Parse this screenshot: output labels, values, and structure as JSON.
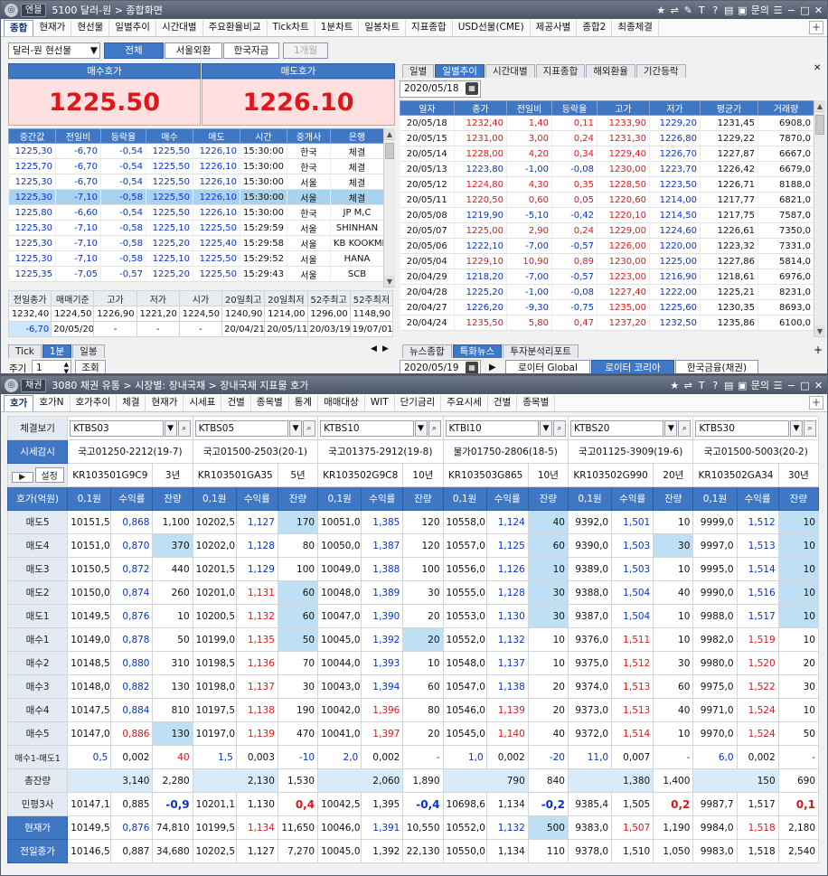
{
  "top": {
    "badge": "엔블",
    "title": "5100 달러-원 > 종합화면",
    "right_label": "문의",
    "menu": [
      "종합",
      "현재가",
      "현선물",
      "일별추이",
      "시간대별",
      "주요환율비교",
      "Tick차트",
      "1분차트",
      "일봉차트",
      "지표종합",
      "USD선물(CME)",
      "제공사별",
      "종합2",
      "최종체결"
    ],
    "instrument": "달러-원 현선물",
    "filters": [
      "전체",
      "서울외환",
      "한국자금",
      "1개월"
    ],
    "bid_label": "매수호가",
    "ask_label": "매도호가",
    "bid": "1225.50",
    "ask": "1226.10",
    "trade_headers": [
      "중간값",
      "전일비",
      "등락율",
      "매수",
      "매도",
      "시간",
      "중개사",
      "은행"
    ],
    "trades": [
      [
        "1225,30",
        "-6,70",
        "-0,54",
        "1225,50",
        "1226,10",
        "15:30:00",
        "한국",
        "체결"
      ],
      [
        "1225,70",
        "-6,70",
        "-0,54",
        "1225,50",
        "1226,10",
        "15:30:00",
        "한국",
        "체결"
      ],
      [
        "1225,30",
        "-6,70",
        "-0,54",
        "1225,50",
        "1226,10",
        "15:30:00",
        "서울",
        "체결"
      ],
      [
        "1225,30",
        "-7,10",
        "-0,58",
        "1225,50",
        "1226,10",
        "15:30:00",
        "서울",
        "체결"
      ],
      [
        "1225,80",
        "-6,60",
        "-0,54",
        "1225,50",
        "1226,10",
        "15:30:00",
        "한국",
        "JP M,C"
      ],
      [
        "1225,30",
        "-7,10",
        "-0,58",
        "1225,10",
        "1225,50",
        "15:29:59",
        "서울",
        "SHINHAN"
      ],
      [
        "1225,30",
        "-7,10",
        "-0,58",
        "1225,20",
        "1225,40",
        "15:29:58",
        "서울",
        "KB KOOKMIN"
      ],
      [
        "1225,30",
        "-7,10",
        "-0,58",
        "1225,10",
        "1225,50",
        "15:29:52",
        "서울",
        "HANA"
      ],
      [
        "1225,35",
        "-7,05",
        "-0,57",
        "1225,20",
        "1225,50",
        "15:29:43",
        "서울",
        "SCB"
      ]
    ],
    "summary_headers": [
      "전일종가",
      "매매기준",
      "고가",
      "저가",
      "시가",
      "20일최고",
      "20일최저",
      "52주최고",
      "52주최저"
    ],
    "summary_row1": [
      "1232,40",
      "1224,50",
      "1226,90",
      "1221,20",
      "1224,50",
      "1240,90",
      "1214,00",
      "1296,00",
      "1148,90"
    ],
    "summary_row2": [
      "-6,70",
      "20/05/20",
      "-",
      "-",
      "-",
      "20/04/21",
      "20/05/11",
      "20/03/19",
      "19/07/01"
    ],
    "bottom_tabs": [
      "Tick",
      "1분",
      "일봉"
    ],
    "period_label": "주기",
    "period_value": "1",
    "query_label": "조회",
    "right_tabs": [
      "일별",
      "일별추이",
      "시간대별",
      "지표종합",
      "해외환율",
      "기간등락"
    ],
    "daily_date": "2020/05/18",
    "daily_headers": [
      "일자",
      "종가",
      "전일비",
      "등락율",
      "고가",
      "저가",
      "평균가",
      "거래량"
    ],
    "daily": [
      [
        "20/05/18",
        "1232,40",
        "1,40",
        "0,11",
        "1233,90",
        "1229,20",
        "1231,45",
        "6908,0"
      ],
      [
        "20/05/15",
        "1231,00",
        "3,00",
        "0,24",
        "1231,30",
        "1226,80",
        "1229,22",
        "7870,0"
      ],
      [
        "20/05/14",
        "1228,00",
        "4,20",
        "0,34",
        "1229,40",
        "1226,70",
        "1227,87",
        "6667,0"
      ],
      [
        "20/05/13",
        "1223,80",
        "-1,00",
        "-0,08",
        "1230,00",
        "1223,70",
        "1226,42",
        "6679,0"
      ],
      [
        "20/05/12",
        "1224,80",
        "4,30",
        "0,35",
        "1228,50",
        "1223,50",
        "1226,71",
        "8188,0"
      ],
      [
        "20/05/11",
        "1220,50",
        "0,60",
        "0,05",
        "1220,60",
        "1214,00",
        "1217,77",
        "6821,0"
      ],
      [
        "20/05/08",
        "1219,90",
        "-5,10",
        "-0,42",
        "1220,10",
        "1214,50",
        "1217,75",
        "7587,0"
      ],
      [
        "20/05/07",
        "1225,00",
        "2,90",
        "0,24",
        "1229,00",
        "1224,60",
        "1226,61",
        "7350,0"
      ],
      [
        "20/05/06",
        "1222,10",
        "-7,00",
        "-0,57",
        "1226,00",
        "1220,00",
        "1223,32",
        "7331,0"
      ],
      [
        "20/05/04",
        "1229,10",
        "10,90",
        "0,89",
        "1230,00",
        "1225,00",
        "1227,86",
        "5814,0"
      ],
      [
        "20/04/29",
        "1218,20",
        "-7,00",
        "-0,57",
        "1223,00",
        "1216,90",
        "1218,61",
        "6976,0"
      ],
      [
        "20/04/28",
        "1225,20",
        "-1,00",
        "-0,08",
        "1227,40",
        "1222,00",
        "1225,21",
        "8231,0"
      ],
      [
        "20/04/27",
        "1226,20",
        "-9,30",
        "-0,75",
        "1235,00",
        "1225,60",
        "1230,35",
        "8693,0"
      ],
      [
        "20/04/24",
        "1235,50",
        "5,80",
        "0,47",
        "1237,20",
        "1232,50",
        "1235,86",
        "6100,0"
      ]
    ],
    "news_tabs": [
      "뉴스종합",
      "특화뉴스",
      "투자분석리포트"
    ],
    "news_date": "2020/05/19",
    "news_sources": [
      "로이터 Global",
      "로이터 코리아",
      "한국금융(채권)"
    ]
  },
  "bottom": {
    "badge": "채권",
    "title": "3080 채권 유통 > 시장별: 장내국채 > 장내국채 지표물 호가",
    "right_label": "문의",
    "menu": [
      "호가",
      "호가N",
      "호가추이",
      "체결",
      "현재가",
      "시세표",
      "건별",
      "종목별",
      "통계",
      "매매대상",
      "WIT",
      "단기금리",
      "주요시세",
      "건별",
      "종목별"
    ],
    "side": {
      "trade_view": "체결보기",
      "quote_btn": "시세감시",
      "set_btn": "설정",
      "header": "호가(억원)",
      "rows": [
        "매도5",
        "매도4",
        "매도3",
        "매도2",
        "매도1",
        "매수1",
        "매수2",
        "매수3",
        "매수4",
        "매수5",
        "매수1-매도1",
        "총잔량",
        "민평3사",
        "현재가",
        "전일종가"
      ]
    },
    "sub_headers": [
      "0,1원",
      "수익률",
      "잔량"
    ],
    "bonds": [
      {
        "code": "KTBS03",
        "name": "국고01250-2212(19-7)",
        "isin": "KR103501G9C9",
        "tenor": "3년",
        "rows": [
          [
            "10151,5",
            "0,868",
            "1,100"
          ],
          [
            "10151,0",
            "0,870",
            "370"
          ],
          [
            "10150,5",
            "0,872",
            "440"
          ],
          [
            "10150,0",
            "0,874",
            "260"
          ],
          [
            "10149,5",
            "0,876",
            "10"
          ],
          [
            "10149,0",
            "0,878",
            "50"
          ],
          [
            "10148,5",
            "0,880",
            "310"
          ],
          [
            "10148,0",
            "0,882",
            "130"
          ],
          [
            "10147,5",
            "0,884",
            "810"
          ],
          [
            "10147,0",
            "0,886",
            "130"
          ],
          [
            "0,5",
            "0,002",
            "40"
          ]
        ],
        "total": [
          "3,140",
          "2,280"
        ],
        "minpyung": [
          "10147,1",
          "0,885",
          "-0,9"
        ],
        "current": [
          "10149,5",
          "0,876",
          "74,810"
        ],
        "prev": [
          "10146,5",
          "0,887",
          "34,680"
        ]
      },
      {
        "code": "KTBS05",
        "name": "국고01500-2503(20-1)",
        "isin": "KR103501GA35",
        "tenor": "5년",
        "rows": [
          [
            "10202,5",
            "1,127",
            "170"
          ],
          [
            "10202,0",
            "1,128",
            "80"
          ],
          [
            "10201,5",
            "1,129",
            "100"
          ],
          [
            "10201,0",
            "1,131",
            "60"
          ],
          [
            "10200,5",
            "1,132",
            "60"
          ],
          [
            "10199,0",
            "1,135",
            "50"
          ],
          [
            "10198,5",
            "1,136",
            "70"
          ],
          [
            "10198,0",
            "1,137",
            "30"
          ],
          [
            "10197,5",
            "1,138",
            "190"
          ],
          [
            "10197,0",
            "1,139",
            "470"
          ],
          [
            "1,5",
            "0,003",
            "-10"
          ]
        ],
        "total": [
          "2,130",
          "1,530"
        ],
        "minpyung": [
          "10201,1",
          "1,130",
          "0,4"
        ],
        "current": [
          "10199,5",
          "1,134",
          "11,650"
        ],
        "prev": [
          "10202,5",
          "1,127",
          "7,270"
        ]
      },
      {
        "code": "KTBS10",
        "name": "국고01375-2912(19-8)",
        "isin": "KR103502G9C8",
        "tenor": "10년",
        "rows": [
          [
            "10051,0",
            "1,385",
            "120"
          ],
          [
            "10050,0",
            "1,387",
            "120"
          ],
          [
            "10049,0",
            "1,388",
            "100"
          ],
          [
            "10048,0",
            "1,389",
            "30"
          ],
          [
            "10047,0",
            "1,390",
            "20"
          ],
          [
            "10045,0",
            "1,392",
            "20"
          ],
          [
            "10044,0",
            "1,393",
            "10"
          ],
          [
            "10043,0",
            "1,394",
            "60"
          ],
          [
            "10042,0",
            "1,396",
            "80"
          ],
          [
            "10041,0",
            "1,397",
            "20"
          ],
          [
            "2,0",
            "0,002",
            "-"
          ]
        ],
        "total": [
          "2,060",
          "1,890"
        ],
        "minpyung": [
          "10042,5",
          "1,395",
          "-0,4"
        ],
        "current": [
          "10046,0",
          "1,391",
          "10,550"
        ],
        "prev": [
          "10045,0",
          "1,392",
          "22,130"
        ]
      },
      {
        "code": "KTBI10",
        "name": "물가01750-2806(18-5)",
        "isin": "KR103503G865",
        "tenor": "10년",
        "rows": [
          [
            "10558,0",
            "1,124",
            "40"
          ],
          [
            "10557,0",
            "1,125",
            "60"
          ],
          [
            "10556,0",
            "1,126",
            "10"
          ],
          [
            "10555,0",
            "1,128",
            "30"
          ],
          [
            "10553,0",
            "1,130",
            "30"
          ],
          [
            "10552,0",
            "1,132",
            "10"
          ],
          [
            "10548,0",
            "1,137",
            "10"
          ],
          [
            "10547,0",
            "1,138",
            "20"
          ],
          [
            "10546,0",
            "1,139",
            "20"
          ],
          [
            "10545,0",
            "1,140",
            "40"
          ],
          [
            "1,0",
            "0,002",
            "-20"
          ]
        ],
        "total": [
          "790",
          "840"
        ],
        "minpyung": [
          "10698,6",
          "1,134",
          "-0,2"
        ],
        "current": [
          "10552,0",
          "1,132",
          "500"
        ],
        "prev": [
          "10550,0",
          "1,134",
          "110"
        ]
      },
      {
        "code": "KTBS20",
        "name": "국고01125-3909(19-6)",
        "isin": "KR103502G990",
        "tenor": "20년",
        "rows": [
          [
            "9392,0",
            "1,501",
            "10"
          ],
          [
            "9390,0",
            "1,503",
            "30"
          ],
          [
            "9389,0",
            "1,503",
            "10"
          ],
          [
            "9388,0",
            "1,504",
            "40"
          ],
          [
            "9387,0",
            "1,504",
            "10"
          ],
          [
            "9376,0",
            "1,511",
            "10"
          ],
          [
            "9375,0",
            "1,512",
            "30"
          ],
          [
            "9374,0",
            "1,513",
            "60"
          ],
          [
            "9373,0",
            "1,513",
            "40"
          ],
          [
            "9372,0",
            "1,514",
            "10"
          ],
          [
            "11,0",
            "0,007",
            "-"
          ]
        ],
        "total": [
          "1,380",
          "1,400"
        ],
        "minpyung": [
          "9385,4",
          "1,505",
          "0,2"
        ],
        "current": [
          "9383,0",
          "1,507",
          "1,190"
        ],
        "prev": [
          "9378,0",
          "1,510",
          "1,050"
        ]
      },
      {
        "code": "KTBS30",
        "name": "국고01500-5003(20-2)",
        "isin": "KR103502GA34",
        "tenor": "30년",
        "rows": [
          [
            "9999,0",
            "1,512",
            "10"
          ],
          [
            "9997,0",
            "1,513",
            "10"
          ],
          [
            "9995,0",
            "1,514",
            "10"
          ],
          [
            "9990,0",
            "1,516",
            "10"
          ],
          [
            "9988,0",
            "1,517",
            "10"
          ],
          [
            "9982,0",
            "1,519",
            "10"
          ],
          [
            "9980,0",
            "1,520",
            "20"
          ],
          [
            "9975,0",
            "1,522",
            "30"
          ],
          [
            "9971,0",
            "1,524",
            "10"
          ],
          [
            "9970,0",
            "1,524",
            "50"
          ],
          [
            "6,0",
            "0,002",
            "-"
          ]
        ],
        "total": [
          "150",
          "690"
        ],
        "minpyung": [
          "9987,7",
          "1,517",
          "0,1"
        ],
        "current": [
          "9984,0",
          "1,518",
          "2,180"
        ],
        "prev": [
          "9983,0",
          "1,518",
          "2,540"
        ]
      }
    ]
  }
}
